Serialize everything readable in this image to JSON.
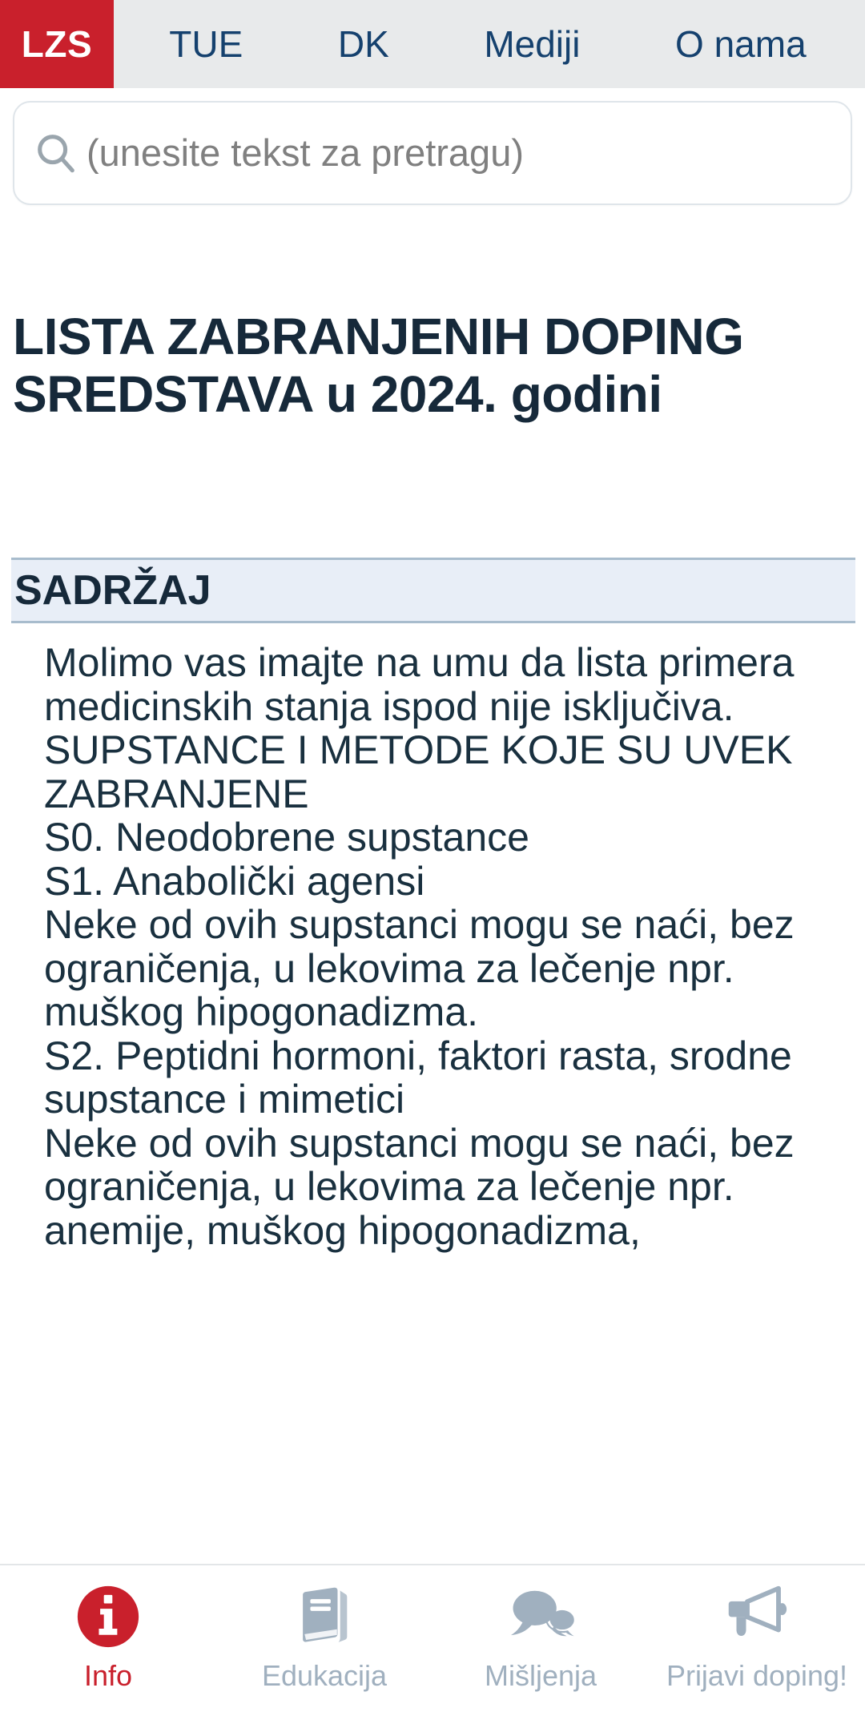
{
  "topbar": {
    "brand": "LZS",
    "brand_color": "#c9202c",
    "background": "#e8eaeb",
    "link_color": "#15416e",
    "items": [
      {
        "label": "TUE"
      },
      {
        "label": "DK"
      },
      {
        "label": "Mediji"
      },
      {
        "label": "O nama"
      }
    ]
  },
  "search": {
    "placeholder": "(unesite tekst za pretragu)",
    "value": "",
    "icon": "search-icon"
  },
  "page": {
    "title": "LISTA ZABRANJENIH DOPING SREDSTAVA u 2024. godini",
    "title_color": "#16293a"
  },
  "section": {
    "heading": "SADRŽAJ",
    "background": "#e8eef7",
    "border_color": "#a8bccd"
  },
  "content": {
    "paragraphs": [
      "Molimo vas imajte na umu da lista primera medicinskih stanja ispod nije isključiva.",
      "SUPSTANCE I METODE KOJE SU UVEK ZABRANJENE",
      "S0. Neodobrene supstance",
      "S1. Anabolički agensi",
      "Neke od ovih supstanci mogu se naći, bez ograničenja, u lekovima za lečenje npr. muškog hipogonadizma.",
      "S2. Peptidni hormoni, faktori rasta, srodne supstance i mimetici",
      "Neke od ovih supstanci mogu se naći, bez ograničenja, u lekovima za lečenje npr. anemije, muškog hipogonadizma,"
    ]
  },
  "tabbar": {
    "active_color": "#c9202c",
    "inactive_color": "#a0b0bf",
    "items": [
      {
        "label": "Info",
        "icon": "info-circle-icon",
        "active": true
      },
      {
        "label": "Edukacija",
        "icon": "book-icon",
        "active": false
      },
      {
        "label": "Mišljenja",
        "icon": "speech-bubbles-icon",
        "active": false
      },
      {
        "label": "Prijavi doping!",
        "icon": "megaphone-icon",
        "active": false
      }
    ]
  }
}
